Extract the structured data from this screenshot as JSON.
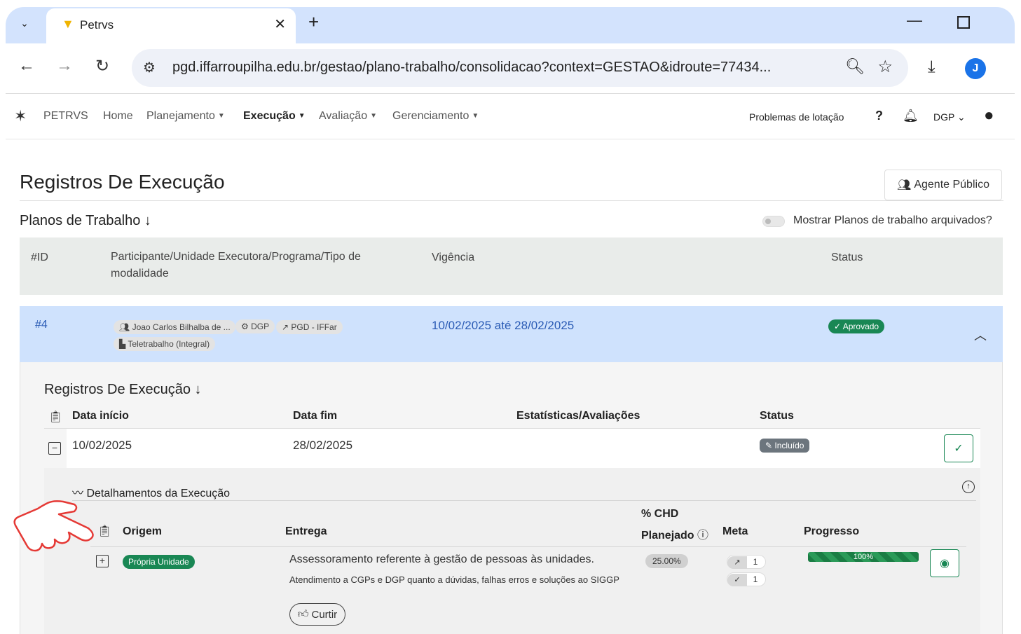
{
  "browser": {
    "tab_title": "Petrvs",
    "url": "pgd.iffarroupilha.edu.br/gestao/plano-trabalho/consolidacao?context=GESTAO&idroute=77434...",
    "profile_initial": "J",
    "icons": [
      "chevron-down-icon",
      "close-icon",
      "plus-icon",
      "back-icon",
      "forward-icon",
      "reload-icon",
      "site-info-icon",
      "zoom-icon",
      "star-icon",
      "download-icon",
      "kebab-icon"
    ]
  },
  "appnav": {
    "brand": "PETRVS",
    "menu": [
      {
        "label": "Home",
        "caret": false
      },
      {
        "label": "Planejamento",
        "caret": true
      },
      {
        "label": "Execução",
        "caret": true,
        "active": true
      },
      {
        "label": "Avaliação",
        "caret": true
      },
      {
        "label": "Gerenciamento",
        "caret": true
      }
    ],
    "problems": "Problemas de lotação",
    "help": "?",
    "unit": "DGP"
  },
  "page": {
    "title": "Registros De Execução",
    "agent_button": "Agente Público",
    "section_title": "Planos de Trabalho ↓",
    "toggle_label": "Mostrar Planos de trabalho arquivados?",
    "columns": {
      "id": "#ID",
      "participant": "Participante/Unidade Executora/Programa/Tipo de modalidade",
      "vigencia": "Vigência",
      "status": "Status"
    },
    "plan": {
      "id": "#4",
      "participant": "Joao Carlos Bilhalba de ...",
      "unit": "DGP",
      "program": "PGD - IFFar",
      "modality": "Teletrabalho (Integral)",
      "period": "10/02/2025 até 28/02/2025",
      "status": "Aprovado"
    },
    "records": {
      "title": "Registros De Execução ↓",
      "columns": {
        "start": "Data início",
        "end": "Data fim",
        "stats": "Estatísticas/Avaliações",
        "status": "Status"
      },
      "row": {
        "start": "10/02/2025",
        "end": "28/02/2025",
        "status": "Incluído"
      }
    },
    "details": {
      "title": "Detalhamentos da Execução",
      "columns": {
        "origin": "Origem",
        "entrega": "Entrega",
        "chd_line1": "% CHD",
        "chd_line2": "Planejado",
        "meta": "Meta",
        "progress": "Progresso"
      },
      "item": {
        "origin": "Própria Unidade",
        "entrega": "Assessoramento referente à gestão de pessoas às unidades.",
        "description": "Atendimento a CGPs e DGP quanto a dúvidas, falhas erros e soluções ao SIGGP",
        "like_label": "Curtir",
        "chd": "25.00%",
        "meta_planned": "1",
        "meta_done": "1",
        "progress": 100,
        "progress_label": "100%"
      }
    }
  },
  "colors": {
    "green": "#198754",
    "row_highlight": "#cfe2fd",
    "link_blue": "#2a5bb5",
    "tabbar": "#d3e3fd"
  }
}
